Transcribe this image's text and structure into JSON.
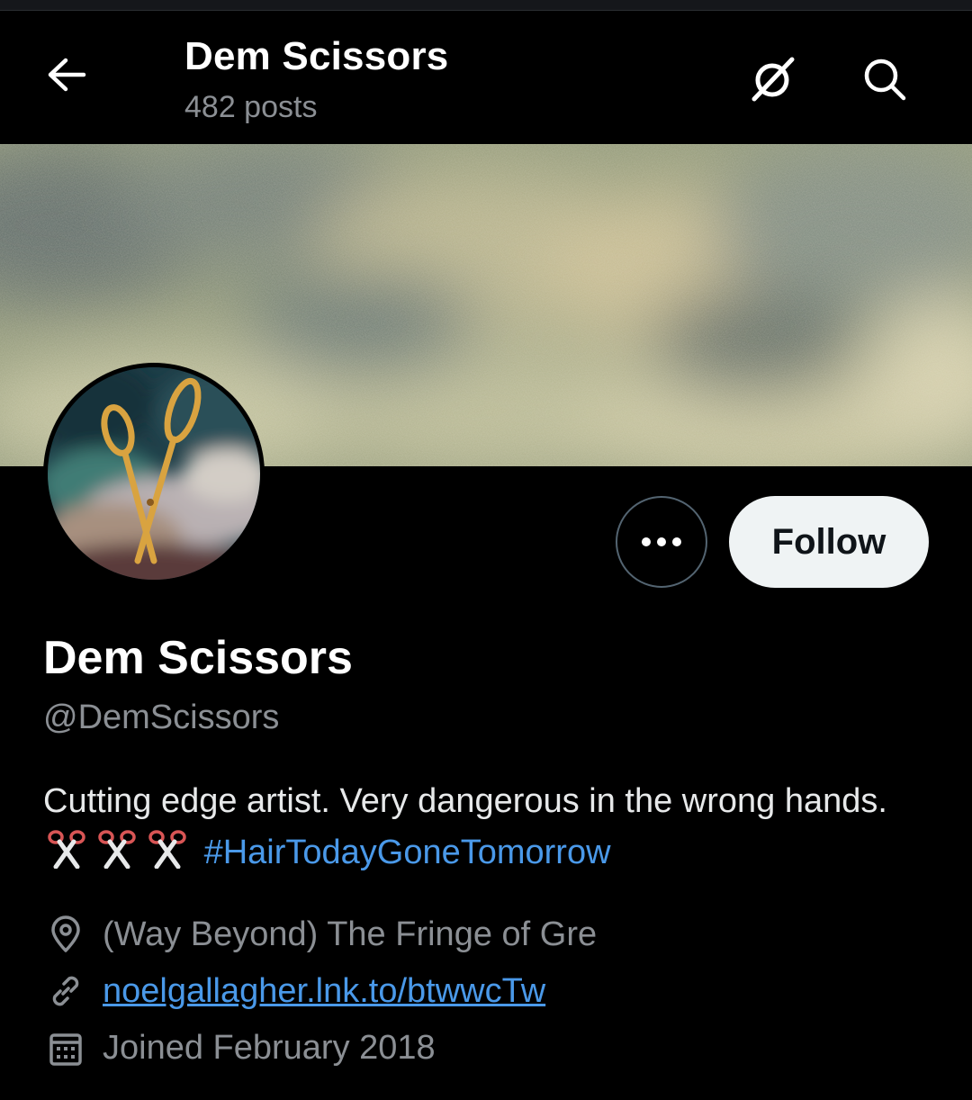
{
  "header": {
    "title": "Dem Scissors",
    "posts_count": "482 posts"
  },
  "profile": {
    "display_name": "Dem Scissors",
    "handle": "@DemScissors",
    "bio_text": "Cutting edge artist. Very dangerous in the wrong hands.",
    "bio_hashtag": "#HairTodayGoneTomorrow",
    "location": "(Way Beyond) The Fringe of Gre",
    "website": "noelgallagher.lnk.to/btwwcTw",
    "joined": "Joined February 2018"
  },
  "buttons": {
    "follow_label": "Follow"
  },
  "icons": {
    "back": "arrow-left-icon",
    "grok": "grok-icon",
    "search": "search-icon",
    "more": "more-horizontal-icon",
    "location": "location-pin-icon",
    "link": "link-icon",
    "calendar": "calendar-icon",
    "bio_emoji": "scissors-emoji x3"
  },
  "colors": {
    "background": "#000000",
    "primary_text": "#e7e9ea",
    "secondary_text": "#8b8f94",
    "accent_link": "#4a99e9",
    "follow_button_bg": "#eff3f4"
  }
}
